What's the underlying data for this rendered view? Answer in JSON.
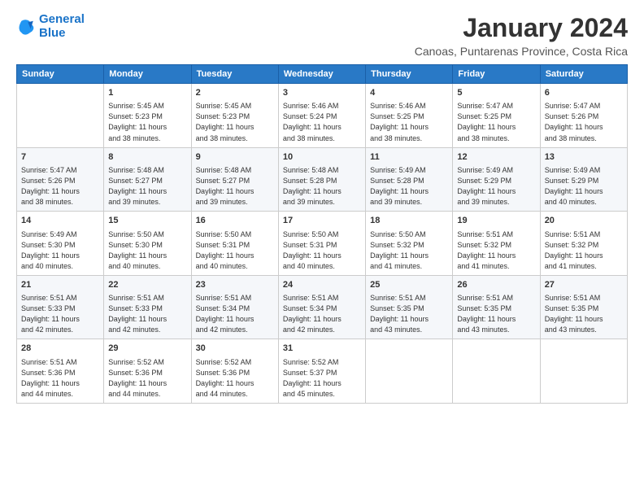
{
  "logo": {
    "line1": "General",
    "line2": "Blue"
  },
  "title": "January 2024",
  "subtitle": "Canoas, Puntarenas Province, Costa Rica",
  "header": {
    "days": [
      "Sunday",
      "Monday",
      "Tuesday",
      "Wednesday",
      "Thursday",
      "Friday",
      "Saturday"
    ]
  },
  "weeks": [
    [
      {
        "day": "",
        "info": ""
      },
      {
        "day": "1",
        "info": "Sunrise: 5:45 AM\nSunset: 5:23 PM\nDaylight: 11 hours\nand 38 minutes."
      },
      {
        "day": "2",
        "info": "Sunrise: 5:45 AM\nSunset: 5:23 PM\nDaylight: 11 hours\nand 38 minutes."
      },
      {
        "day": "3",
        "info": "Sunrise: 5:46 AM\nSunset: 5:24 PM\nDaylight: 11 hours\nand 38 minutes."
      },
      {
        "day": "4",
        "info": "Sunrise: 5:46 AM\nSunset: 5:25 PM\nDaylight: 11 hours\nand 38 minutes."
      },
      {
        "day": "5",
        "info": "Sunrise: 5:47 AM\nSunset: 5:25 PM\nDaylight: 11 hours\nand 38 minutes."
      },
      {
        "day": "6",
        "info": "Sunrise: 5:47 AM\nSunset: 5:26 PM\nDaylight: 11 hours\nand 38 minutes."
      }
    ],
    [
      {
        "day": "7",
        "info": "Sunrise: 5:47 AM\nSunset: 5:26 PM\nDaylight: 11 hours\nand 38 minutes."
      },
      {
        "day": "8",
        "info": "Sunrise: 5:48 AM\nSunset: 5:27 PM\nDaylight: 11 hours\nand 39 minutes."
      },
      {
        "day": "9",
        "info": "Sunrise: 5:48 AM\nSunset: 5:27 PM\nDaylight: 11 hours\nand 39 minutes."
      },
      {
        "day": "10",
        "info": "Sunrise: 5:48 AM\nSunset: 5:28 PM\nDaylight: 11 hours\nand 39 minutes."
      },
      {
        "day": "11",
        "info": "Sunrise: 5:49 AM\nSunset: 5:28 PM\nDaylight: 11 hours\nand 39 minutes."
      },
      {
        "day": "12",
        "info": "Sunrise: 5:49 AM\nSunset: 5:29 PM\nDaylight: 11 hours\nand 39 minutes."
      },
      {
        "day": "13",
        "info": "Sunrise: 5:49 AM\nSunset: 5:29 PM\nDaylight: 11 hours\nand 40 minutes."
      }
    ],
    [
      {
        "day": "14",
        "info": "Sunrise: 5:49 AM\nSunset: 5:30 PM\nDaylight: 11 hours\nand 40 minutes."
      },
      {
        "day": "15",
        "info": "Sunrise: 5:50 AM\nSunset: 5:30 PM\nDaylight: 11 hours\nand 40 minutes."
      },
      {
        "day": "16",
        "info": "Sunrise: 5:50 AM\nSunset: 5:31 PM\nDaylight: 11 hours\nand 40 minutes."
      },
      {
        "day": "17",
        "info": "Sunrise: 5:50 AM\nSunset: 5:31 PM\nDaylight: 11 hours\nand 40 minutes."
      },
      {
        "day": "18",
        "info": "Sunrise: 5:50 AM\nSunset: 5:32 PM\nDaylight: 11 hours\nand 41 minutes."
      },
      {
        "day": "19",
        "info": "Sunrise: 5:51 AM\nSunset: 5:32 PM\nDaylight: 11 hours\nand 41 minutes."
      },
      {
        "day": "20",
        "info": "Sunrise: 5:51 AM\nSunset: 5:32 PM\nDaylight: 11 hours\nand 41 minutes."
      }
    ],
    [
      {
        "day": "21",
        "info": "Sunrise: 5:51 AM\nSunset: 5:33 PM\nDaylight: 11 hours\nand 42 minutes."
      },
      {
        "day": "22",
        "info": "Sunrise: 5:51 AM\nSunset: 5:33 PM\nDaylight: 11 hours\nand 42 minutes."
      },
      {
        "day": "23",
        "info": "Sunrise: 5:51 AM\nSunset: 5:34 PM\nDaylight: 11 hours\nand 42 minutes."
      },
      {
        "day": "24",
        "info": "Sunrise: 5:51 AM\nSunset: 5:34 PM\nDaylight: 11 hours\nand 42 minutes."
      },
      {
        "day": "25",
        "info": "Sunrise: 5:51 AM\nSunset: 5:35 PM\nDaylight: 11 hours\nand 43 minutes."
      },
      {
        "day": "26",
        "info": "Sunrise: 5:51 AM\nSunset: 5:35 PM\nDaylight: 11 hours\nand 43 minutes."
      },
      {
        "day": "27",
        "info": "Sunrise: 5:51 AM\nSunset: 5:35 PM\nDaylight: 11 hours\nand 43 minutes."
      }
    ],
    [
      {
        "day": "28",
        "info": "Sunrise: 5:51 AM\nSunset: 5:36 PM\nDaylight: 11 hours\nand 44 minutes."
      },
      {
        "day": "29",
        "info": "Sunrise: 5:52 AM\nSunset: 5:36 PM\nDaylight: 11 hours\nand 44 minutes."
      },
      {
        "day": "30",
        "info": "Sunrise: 5:52 AM\nSunset: 5:36 PM\nDaylight: 11 hours\nand 44 minutes."
      },
      {
        "day": "31",
        "info": "Sunrise: 5:52 AM\nSunset: 5:37 PM\nDaylight: 11 hours\nand 45 minutes."
      },
      {
        "day": "",
        "info": ""
      },
      {
        "day": "",
        "info": ""
      },
      {
        "day": "",
        "info": ""
      }
    ]
  ]
}
